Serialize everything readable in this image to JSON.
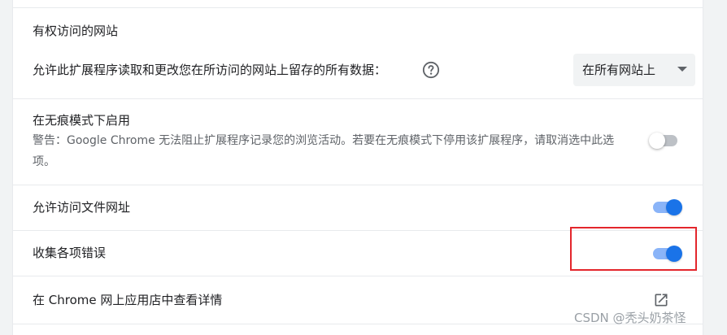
{
  "site_access": {
    "heading": "有权访问的网站",
    "description": "允许此扩展程序读取和更改您在所访问的网站上留存的所有数据：",
    "help_icon": "help-circle-icon",
    "select_value": "在所有网站上"
  },
  "incognito": {
    "title": "在无痕模式下启用",
    "warning": "警告：Google Chrome 无法阻止扩展程序记录您的浏览活动。若要在无痕模式下停用该扩展程序，请取消选中此选项。",
    "enabled": false
  },
  "file_urls": {
    "label": "允许访问文件网址",
    "enabled": true
  },
  "collect_errors": {
    "label": "收集各项错误",
    "enabled": true
  },
  "store_link": {
    "label": "在 Chrome 网上应用店中查看详情",
    "icon": "open-in-new-icon"
  },
  "colors": {
    "accent": "#1a73e8",
    "toggle_on_track": "#8ab4f8",
    "highlight": "#e3262c"
  },
  "watermark": "CSDN @秃头奶茶怪"
}
